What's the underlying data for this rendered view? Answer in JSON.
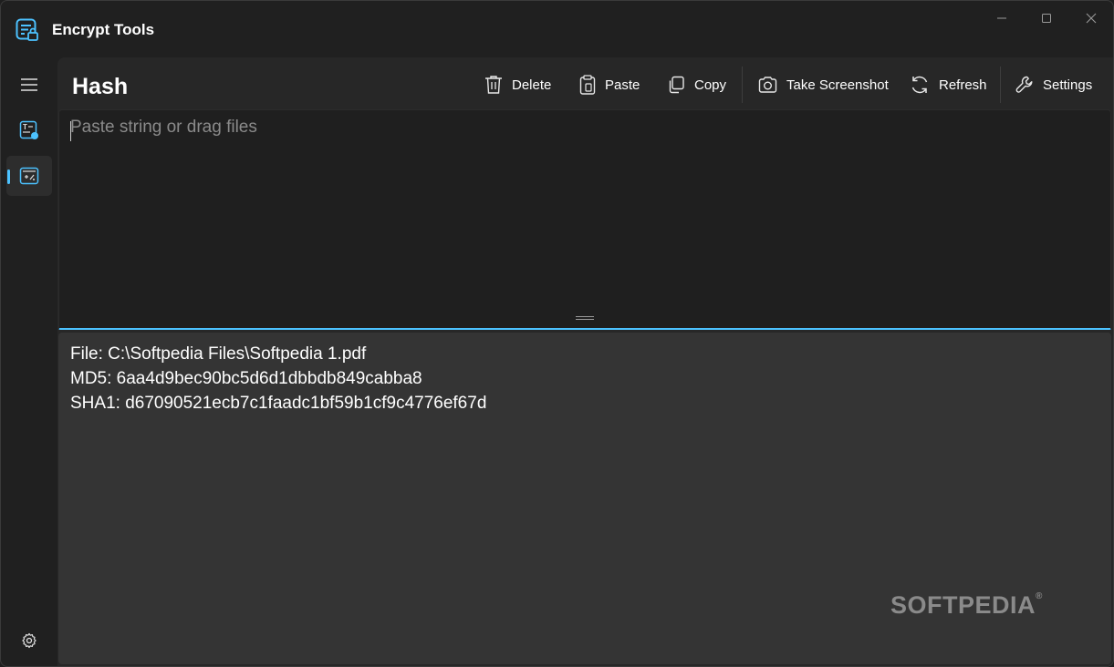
{
  "window": {
    "title": "Encrypt Tools",
    "accent_color": "#4cc2ff",
    "controls": {
      "minimize_icon": "minimize-icon",
      "maximize_icon": "maximize-icon",
      "close_icon": "close-icon"
    }
  },
  "nav": {
    "items": [
      {
        "name": "menu",
        "icon": "hamburger-icon"
      },
      {
        "name": "text-encrypt",
        "icon": "text-lock-icon"
      },
      {
        "name": "hash",
        "icon": "hash-icon",
        "selected": true
      }
    ],
    "footer_icon": "gear-icon"
  },
  "page": {
    "title": "Hash"
  },
  "toolbar": {
    "delete_label": "Delete",
    "paste_label": "Paste",
    "copy_label": "Copy",
    "screenshot_label": "Take Screenshot",
    "refresh_label": "Refresh",
    "settings_label": "Settings"
  },
  "input": {
    "placeholder": "Paste string or drag files",
    "value": ""
  },
  "output": {
    "lines": [
      "File: C:\\Softpedia Files\\Softpedia 1.pdf",
      "MD5: 6aa4d9bec90bc5d6d1dbbdb849cabba8",
      "SHA1: d67090521ecb7c1faadc1bf59b1cf9c4776ef67d"
    ]
  },
  "watermark": {
    "text": "SOFTPEDIA",
    "mark": "®"
  }
}
